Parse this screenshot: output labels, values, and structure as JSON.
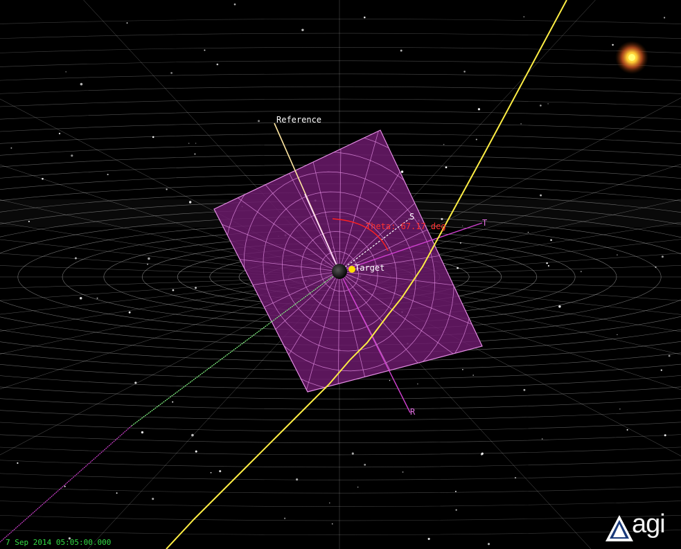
{
  "view": {
    "labels": {
      "reference": "Reference",
      "s_axis": "S",
      "t_axis": "T",
      "r_axis": "R",
      "theta": "Theta: 67.17 deg",
      "target": "Target"
    },
    "timestamp": "7 Sep 2014 05:05:00.000",
    "logo_text": "agi",
    "colors": {
      "background": "#000000",
      "grid": "#bfbfbf",
      "b_plane": "#7a1f7a",
      "b_plane_grid": "#e08ae0",
      "trajectory": "#ffee44",
      "reference": "#ffe6a0",
      "theta": "#ff2020",
      "axis": "#d040d0",
      "incoming": "#88ff88",
      "sun": "#ffee33",
      "timestamp": "#33dd44"
    },
    "icons": [
      "sun-icon",
      "target-icon",
      "planet-icon",
      "agi-logo-icon"
    ]
  }
}
